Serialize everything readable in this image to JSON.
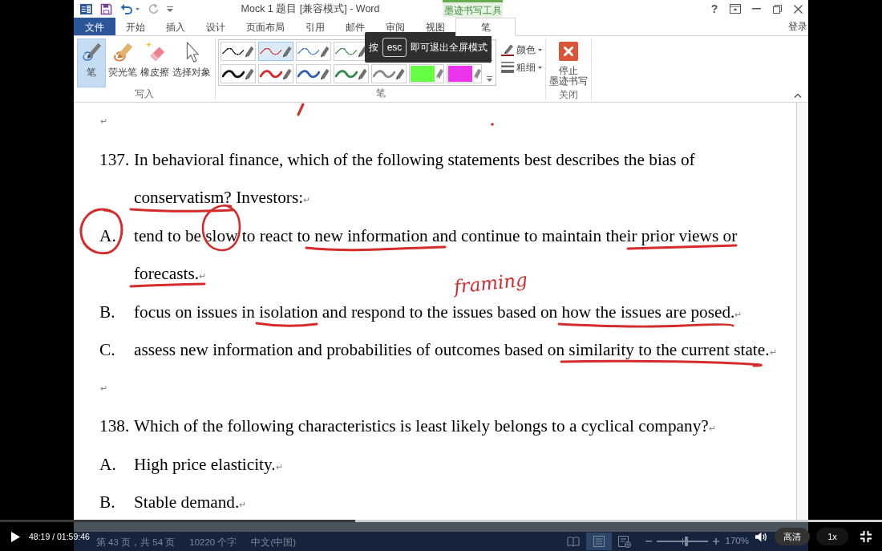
{
  "title_bar": {
    "title": "Mock 1 题目 [兼容模式] - Word",
    "context_header": "墨迹书写工具",
    "help": "?",
    "sign_in": "登录"
  },
  "tabs": [
    {
      "label": "文件",
      "kind": "file",
      "selected": false
    },
    {
      "label": "开始",
      "kind": "tab",
      "selected": false
    },
    {
      "label": "插入",
      "kind": "tab",
      "selected": false
    },
    {
      "label": "设计",
      "kind": "tab",
      "selected": false
    },
    {
      "label": "页面布局",
      "kind": "tab",
      "selected": false
    },
    {
      "label": "引用",
      "kind": "tab",
      "selected": false
    },
    {
      "label": "邮件",
      "kind": "tab",
      "selected": false
    },
    {
      "label": "审阅",
      "kind": "tab",
      "selected": false
    },
    {
      "label": "视图",
      "kind": "tab",
      "selected": false
    },
    {
      "label": "笔",
      "kind": "contextual",
      "selected": true
    }
  ],
  "ribbon": {
    "write_group": {
      "label": "写入",
      "tools": [
        {
          "label": "笔",
          "kind": "pen",
          "selected": true
        },
        {
          "label": "荧光笔",
          "kind": "highlighter",
          "selected": false
        },
        {
          "label": "橡皮擦",
          "kind": "eraser",
          "selected": false
        },
        {
          "label": "选择对象",
          "kind": "select",
          "selected": false
        }
      ]
    },
    "pen_group": {
      "label": "笔",
      "pen_rows": [
        {
          "pens": [
            {
              "kind": "thin",
              "color": "#3a3a3a",
              "selected": false
            },
            {
              "kind": "thin",
              "color": "#d9534f",
              "selected": true
            },
            {
              "kind": "thin",
              "color": "#5b8fd6",
              "selected": false
            },
            {
              "kind": "thin",
              "color": "#5aa36f",
              "selected": false
            }
          ]
        },
        {
          "pens": [
            {
              "kind": "thick",
              "color": "#111111",
              "selected": false
            },
            {
              "kind": "thick",
              "color": "#d42a2a",
              "selected": false
            },
            {
              "kind": "thick",
              "color": "#2f5fb3",
              "selected": false
            },
            {
              "kind": "thick",
              "color": "#2e8b4a",
              "selected": false
            },
            {
              "kind": "thick",
              "color": "#8a8a8a",
              "selected": false
            },
            {
              "kind": "highlighter",
              "color": "#66ff44",
              "selected": false
            },
            {
              "kind": "highlighter",
              "color": "#ee33ee",
              "selected": false
            }
          ]
        }
      ],
      "options": [
        {
          "kind": "color",
          "label": "颜色"
        },
        {
          "kind": "weight",
          "label": "粗细"
        }
      ]
    },
    "close_group": {
      "label": "关闭",
      "button_lines": [
        "停止",
        "墨迹书写"
      ]
    }
  },
  "toast": {
    "prefix": "按",
    "key": "esc",
    "suffix": "即可退出全屏模式"
  },
  "document": {
    "paragraphs": [
      {
        "kind": "blank",
        "end_mark": "↵"
      },
      {
        "kind": "question",
        "label": "137.",
        "lines": [
          "In behavioral finance, which of the following statements best describes the bias of",
          "conservatism? Investors:"
        ],
        "end_mark": "↵"
      },
      {
        "kind": "option",
        "label": "A.",
        "lines": [
          "tend to be slow to react to new information and continue to maintain their prior views or",
          "forecasts."
        ],
        "end_mark": "↵"
      },
      {
        "kind": "option",
        "label": "B.",
        "lines": [
          "focus on issues in isolation and respond to the issues based on how the issues are posed."
        ],
        "end_mark": "↵"
      },
      {
        "kind": "option",
        "label": "C.",
        "lines": [
          "assess new information and probabilities of outcomes based on similarity to the current state."
        ],
        "end_mark": "↵"
      },
      {
        "kind": "blank",
        "end_mark": "↵"
      },
      {
        "kind": "question",
        "label": "138.",
        "lines": [
          "Which of the following characteristics is least likely belongs to a cyclical company?"
        ],
        "end_mark": "↵"
      },
      {
        "kind": "option",
        "label": "A.",
        "lines": [
          "High price elasticity."
        ],
        "end_mark": "↵"
      },
      {
        "kind": "option",
        "label": "B.",
        "lines": [
          "Stable demand."
        ],
        "end_mark": "↵"
      }
    ],
    "handwriting": "framing"
  },
  "status_bar": {
    "page": "第 43 页，共 54 页",
    "words": "10220 个字",
    "language": "中文(中国)",
    "views": [
      {
        "kind": "read",
        "selected": false
      },
      {
        "kind": "print",
        "selected": true
      },
      {
        "kind": "web",
        "selected": false
      }
    ],
    "zoom": {
      "level": 0.58,
      "reading": "170%"
    }
  },
  "video": {
    "time": "48:19 / 01:59:46",
    "progress": {
      "level": 0.403
    },
    "quality": "高清",
    "speed": "1x"
  }
}
